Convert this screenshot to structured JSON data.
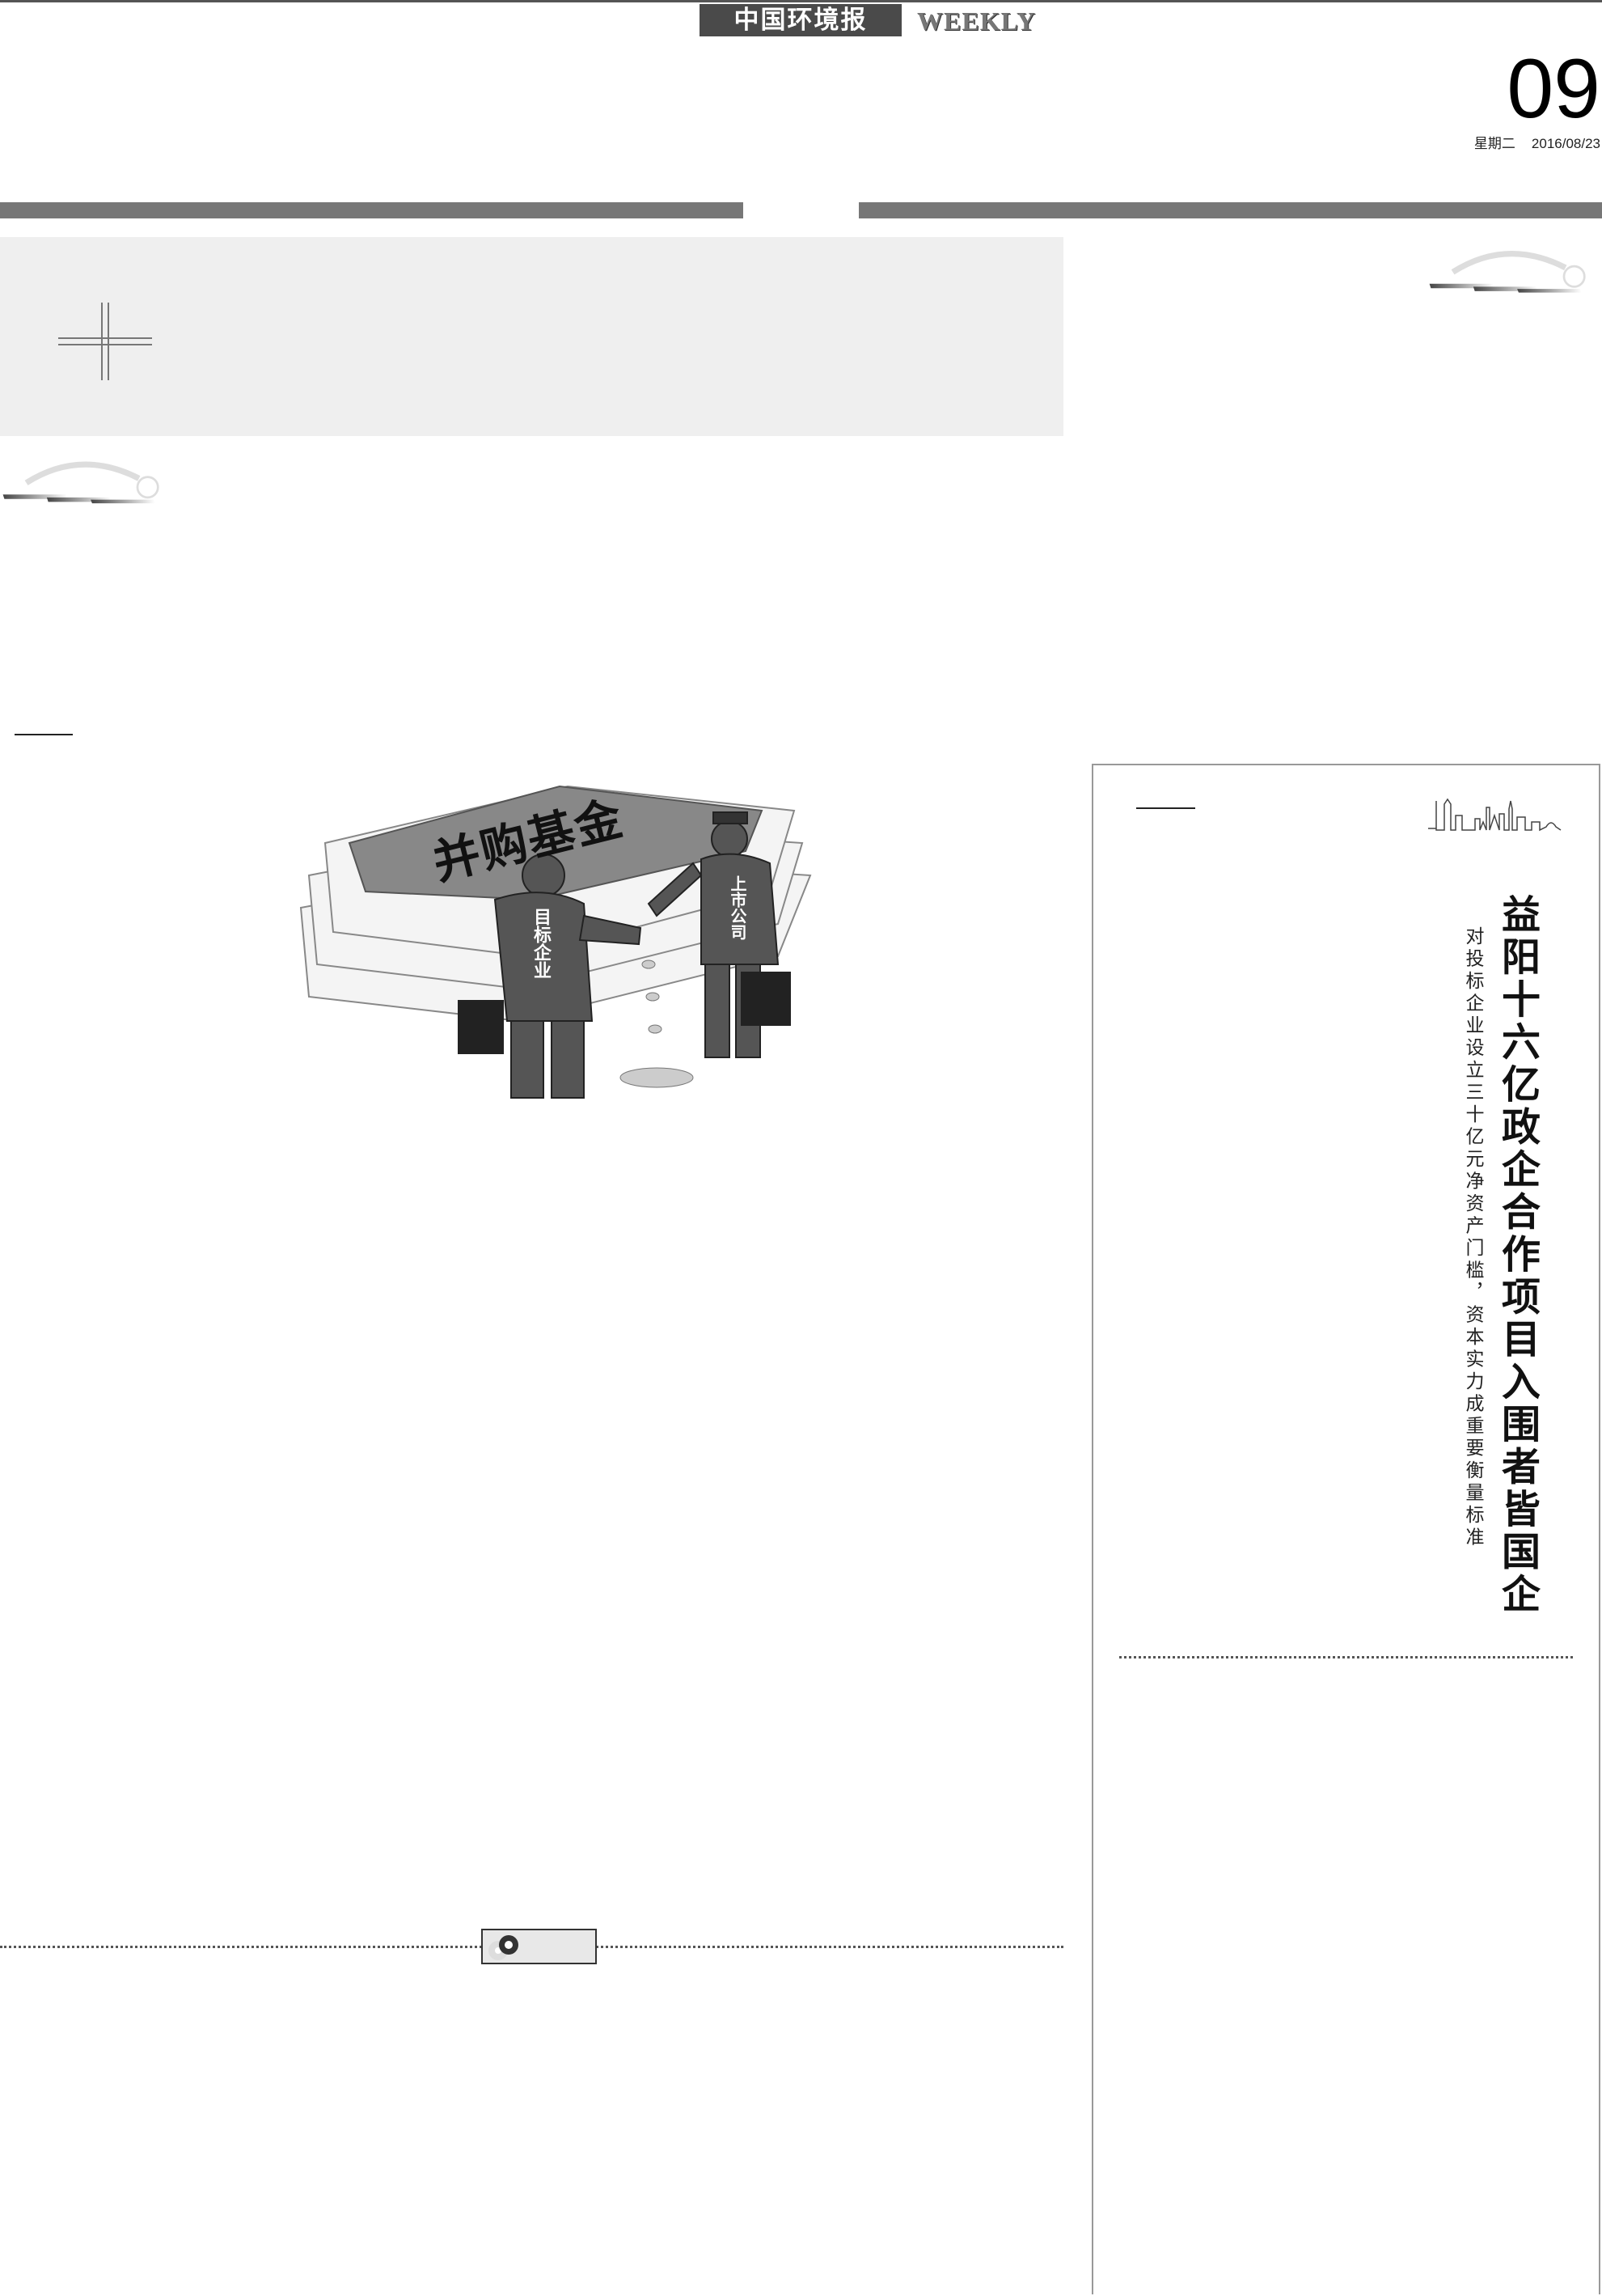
{
  "masthead": {
    "logo_text": "中国环境报",
    "edition": "WEEKLY",
    "page_number": "09",
    "weekday": "星期二",
    "date": "2016/08/23"
  },
  "illustration": {
    "banner_text": "并购基金",
    "left_figure_label": "目标企业",
    "right_figure_label": "上市公司"
  },
  "sidebar_article": {
    "headline": "益阳十六亿政企合作项目入围者皆国企",
    "subheadline": "对投标企业设立三十亿元净资产门槛，资本实力成重要衡量标准"
  }
}
